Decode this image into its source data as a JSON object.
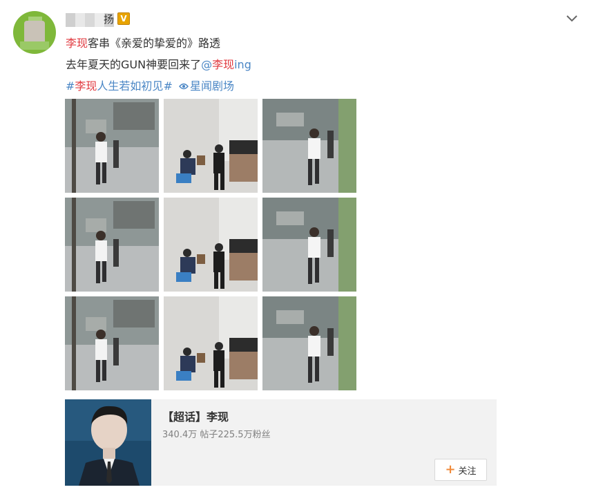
{
  "post": {
    "username_tail": "扬",
    "verified_badge": "V",
    "line1": {
      "mention": "李现",
      "text": "客串《亲爱的挚爱的》路透"
    },
    "line2": {
      "text": "去年夏天的GUN神要回来了",
      "at": "@",
      "mention": "李现",
      "suffix": "ing"
    },
    "line3": {
      "hash_open": "#",
      "topic": "李现",
      "topic_rest": "人生若如初见",
      "hash_close": "#",
      "location": "星闻剧场"
    }
  },
  "photos": [
    {
      "scene": "walk"
    },
    {
      "scene": "seated"
    },
    {
      "scene": "walk2"
    },
    {
      "scene": "walk"
    },
    {
      "scene": "seated"
    },
    {
      "scene": "walk2"
    },
    {
      "scene": "walk"
    },
    {
      "scene": "seated"
    },
    {
      "scene": "walk2"
    }
  ],
  "supertopic": {
    "title": "【超话】李现",
    "stats": "340.4万  帖子225.5万粉丝",
    "follow_label": "关注",
    "follow_icon": "plus-icon"
  },
  "icons": {
    "more": "chevron-down-icon",
    "location": "location-pin-icon"
  },
  "colors": {
    "mention_red": "#e0383e",
    "link_blue": "#4a86c5",
    "follow_plus": "#f08a3a",
    "verified": "#e8a400"
  }
}
